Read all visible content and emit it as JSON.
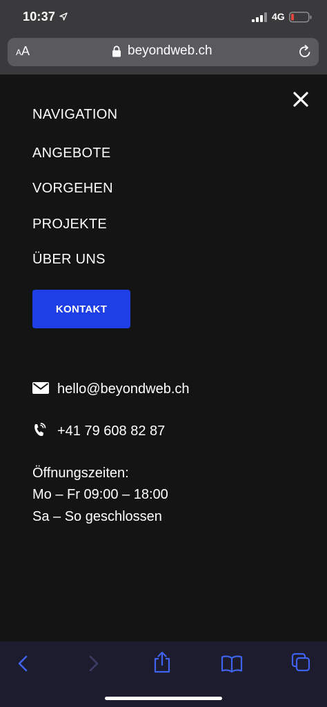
{
  "status_bar": {
    "time": "10:37",
    "network": "4G"
  },
  "browser": {
    "text_size_label_small": "A",
    "text_size_label_large": "A",
    "url": "beyondweb.ch"
  },
  "menu": {
    "title": "NAVIGATION",
    "items": [
      {
        "label": "ANGEBOTE"
      },
      {
        "label": "VORGEHEN"
      },
      {
        "label": "PROJEKTE"
      },
      {
        "label": "ÜBER UNS"
      }
    ],
    "cta_label": "KONTAKT"
  },
  "contact": {
    "email": "hello@beyondweb.ch",
    "phone": "+41 79 608 82 87",
    "hours_title": "Öffnungszeiten:",
    "hours_weekday": "Mo – Fr 09:00 – 18:00",
    "hours_weekend": "Sa – So geschlossen"
  },
  "colors": {
    "background": "#141414",
    "accent": "#1e3ee6",
    "toolbar_icon": "#3f63f0",
    "battery_low": "#e0463c"
  },
  "icons": {
    "close": "close-icon",
    "email": "envelope-icon",
    "phone": "phone-icon",
    "back": "chevron-left-icon",
    "forward": "chevron-right-icon",
    "share": "share-icon",
    "bookmarks": "book-icon",
    "tabs": "tabs-icon"
  }
}
